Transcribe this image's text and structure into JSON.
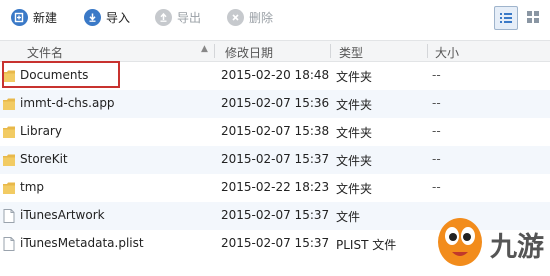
{
  "toolbar": {
    "new_label": "新建",
    "import_label": "导入",
    "export_label": "导出",
    "delete_label": "删除"
  },
  "columns": {
    "name": "文件名",
    "date": "修改日期",
    "type": "类型",
    "size": "大小"
  },
  "files": [
    {
      "name": "Documents",
      "date": "2015-02-20 18:48",
      "type": "文件夹",
      "size": "--",
      "icon": "folder-icon"
    },
    {
      "name": "immt-d-chs.app",
      "date": "2015-02-07 15:36",
      "type": "文件夹",
      "size": "--",
      "icon": "folder-icon"
    },
    {
      "name": "Library",
      "date": "2015-02-07 15:38",
      "type": "文件夹",
      "size": "--",
      "icon": "folder-icon"
    },
    {
      "name": "StoreKit",
      "date": "2015-02-07 15:37",
      "type": "文件夹",
      "size": "--",
      "icon": "folder-icon"
    },
    {
      "name": "tmp",
      "date": "2015-02-22 18:23",
      "type": "文件夹",
      "size": "--",
      "icon": "folder-icon"
    },
    {
      "name": "iTunesArtwork",
      "date": "2015-02-07 15:37",
      "type": "文件",
      "size": "",
      "icon": "file-icon"
    },
    {
      "name": "iTunesMetadata.plist",
      "date": "2015-02-07 15:37",
      "type": "PLIST 文件",
      "size": "",
      "icon": "file-icon"
    }
  ],
  "watermark": {
    "text": "九游"
  },
  "colors": {
    "accent": "#3a79c7",
    "highlight": "#c8322f",
    "folder": "#e8b84a"
  }
}
